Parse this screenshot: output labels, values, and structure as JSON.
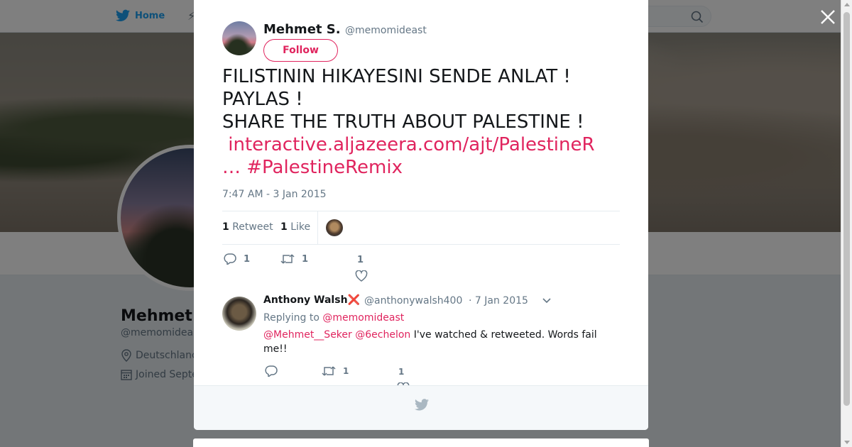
{
  "nav": {
    "home_label": "Home"
  },
  "profile": {
    "name": "Mehmet",
    "handle": "@memomidea",
    "location": "Deutschlanc",
    "joined": "Joined Septe"
  },
  "tweet": {
    "author_name": "Mehmet S.",
    "author_handle": "@memomideast",
    "follow_label": "Follow",
    "text_line1": "FILISTININ HIKAYESINI SENDE ANLAT !",
    "text_line2": "PAYLAS !",
    "text_line3": "SHARE THE TRUTH ABOUT PALESTINE !",
    "link_url": "interactive.aljazeera.com/ajt/PalestineR",
    "link_ellipsis": "…",
    "hashtag": "#PalestineRemix",
    "timestamp": "7:47 AM - 3 Jan 2015",
    "retweet_count": "1",
    "retweet_label": "Retweet",
    "like_count": "1",
    "like_label": "Like",
    "actions": {
      "reply_count": "1",
      "retweet_count": "1",
      "like_count": "1"
    }
  },
  "reply": {
    "author_name": "Anthony Walsh",
    "author_badge": "❌",
    "author_handle": "@anthonywalsh400",
    "date": "· 7 Jan 2015",
    "replying_label": "Replying to",
    "replying_handle": "@memomideast",
    "mention1": "@Mehmet__Seker",
    "mention2": "@6echelon",
    "text": "I've watched & retweeted. Words fail me!!",
    "actions": {
      "retweet_count": "1",
      "like_count": "1"
    }
  },
  "colors": {
    "accent": "#e0245e",
    "twitter_blue": "#1da1f2",
    "muted": "#657786"
  },
  "icons": [
    "twitter-bird-icon",
    "search-icon",
    "close-icon",
    "location-icon",
    "calendar-icon",
    "reply-icon",
    "retweet-icon",
    "heart-icon",
    "chevron-down-icon"
  ]
}
